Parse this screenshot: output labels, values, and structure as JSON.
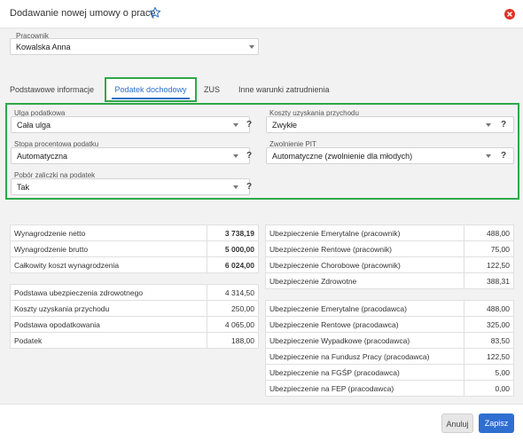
{
  "header": {
    "title": "Dodawanie nowej umowy o pracę"
  },
  "employee": {
    "label": "Pracownik",
    "value": "Kowalska Anna"
  },
  "tabs": [
    {
      "label": "Podstawowe informacje"
    },
    {
      "label": "Podatek dochodowy"
    },
    {
      "label": "ZUS"
    },
    {
      "label": "Inne warunki zatrudnienia"
    }
  ],
  "tax": {
    "relief": {
      "label": "Ulga podatkowa",
      "value": "Cała ulga"
    },
    "costs": {
      "label": "Koszty uzyskania przychodu",
      "value": "Zwykłe"
    },
    "rate": {
      "label": "Stopa procentowa podatku",
      "value": "Automatyczna"
    },
    "exemption": {
      "label": "Zwolnienie PIT",
      "value": "Automatyczne (zwolnienie dla młodych)"
    },
    "advance": {
      "label": "Pobór zaliczki na podatek",
      "value": "Tak"
    },
    "help_mark": "?"
  },
  "summary": [
    {
      "label": "Wynagrodzenie netto",
      "value": "3 738,19"
    },
    {
      "label": "Wynagrodzenie brutto",
      "value": "5 000,00"
    },
    {
      "label": "Całkowity koszt wynagrodzenia",
      "value": "6 024,00"
    }
  ],
  "tax_base": [
    {
      "label": "Podstawa ubezpieczenia zdrowotnego",
      "value": "4 314,50"
    },
    {
      "label": "Koszty uzyskania przychodu",
      "value": "250,00"
    },
    {
      "label": "Podstawa opodatkowania",
      "value": "4 065,00"
    },
    {
      "label": "Podatek",
      "value": "188,00"
    }
  ],
  "employee_insurance": [
    {
      "label": "Ubezpieczenie Emerytalne (pracownik)",
      "value": "488,00"
    },
    {
      "label": "Ubezpieczenie Rentowe (pracownik)",
      "value": "75,00"
    },
    {
      "label": "Ubezpieczenie Chorobowe (pracownik)",
      "value": "122,50"
    },
    {
      "label": "Ubezpieczenie Zdrowotne",
      "value": "388,31"
    }
  ],
  "employer_insurance": [
    {
      "label": "Ubezpieczenie Emerytalne (pracodawca)",
      "value": "488,00"
    },
    {
      "label": "Ubezpieczenie Rentowe (pracodawca)",
      "value": "325,00"
    },
    {
      "label": "Ubezpieczenie Wypadkowe (pracodawca)",
      "value": "83,50"
    },
    {
      "label": "Ubezpieczenie na Fundusz Pracy (pracodawca)",
      "value": "122,50"
    },
    {
      "label": "Ubezpieczenie na FGŚP (pracodawca)",
      "value": "5,00"
    },
    {
      "label": "Ubezpieczenie na FEP (pracodawca)",
      "value": "0,00"
    }
  ],
  "footer": {
    "cancel_label": "Anuluj",
    "save_label": "Zapisz"
  },
  "colors": {
    "accent": "#2f6fd1",
    "highlight": "#2ea84a",
    "close": "#e0322a"
  }
}
